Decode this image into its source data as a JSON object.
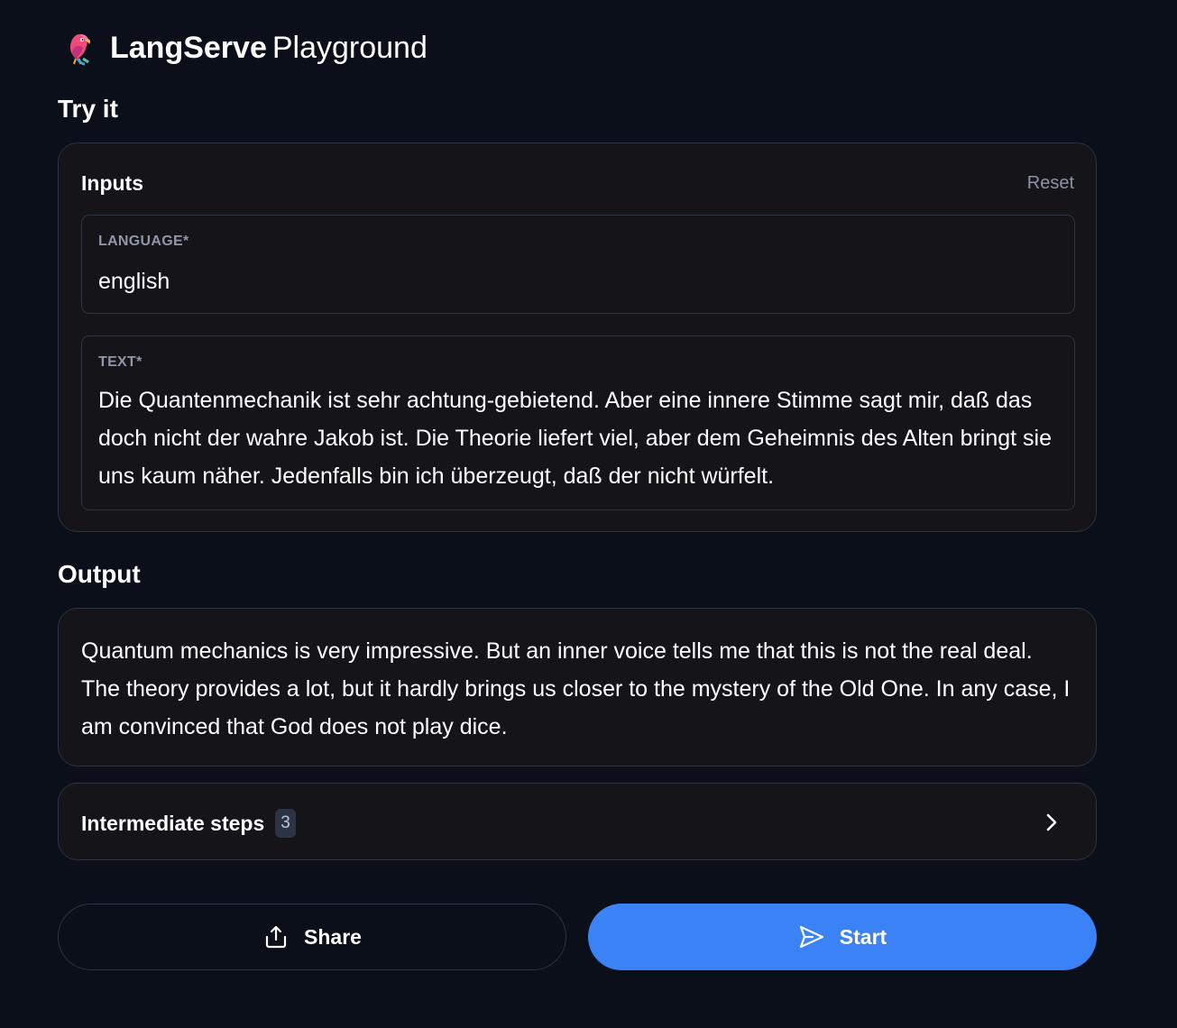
{
  "header": {
    "brand": "LangServe",
    "subtitle": "Playground",
    "logo_icon": "parrot-icon"
  },
  "try_it": {
    "heading": "Try it",
    "inputs_title": "Inputs",
    "reset_label": "Reset",
    "fields": [
      {
        "label": "LANGUAGE*",
        "value": "english"
      },
      {
        "label": "TEXT*",
        "value": "Die Quantenmechanik ist sehr achtung-gebietend. Aber eine innere Stimme sagt mir, daß das doch nicht der wahre Jakob ist. Die Theorie liefert viel, aber dem Geheimnis des Alten bringt sie uns kaum näher. Jedenfalls bin ich überzeugt, daß der nicht würfelt."
      }
    ]
  },
  "output": {
    "heading": "Output",
    "text": "Quantum mechanics is very impressive. But an inner voice tells me that this is not the real deal. The theory provides a lot, but it hardly brings us closer to the mystery of the Old One. In any case, I am convinced that God does not play dice."
  },
  "steps": {
    "label": "Intermediate steps",
    "count": "3",
    "icon": "chevron-right-icon"
  },
  "actions": {
    "share_label": "Share",
    "share_icon": "share-upload-icon",
    "start_label": "Start",
    "start_icon": "send-icon"
  },
  "colors": {
    "background": "#0b0f19",
    "card": "#151419",
    "border": "#2d3340",
    "muted": "#8b93a4",
    "accent": "#3b82f6"
  }
}
